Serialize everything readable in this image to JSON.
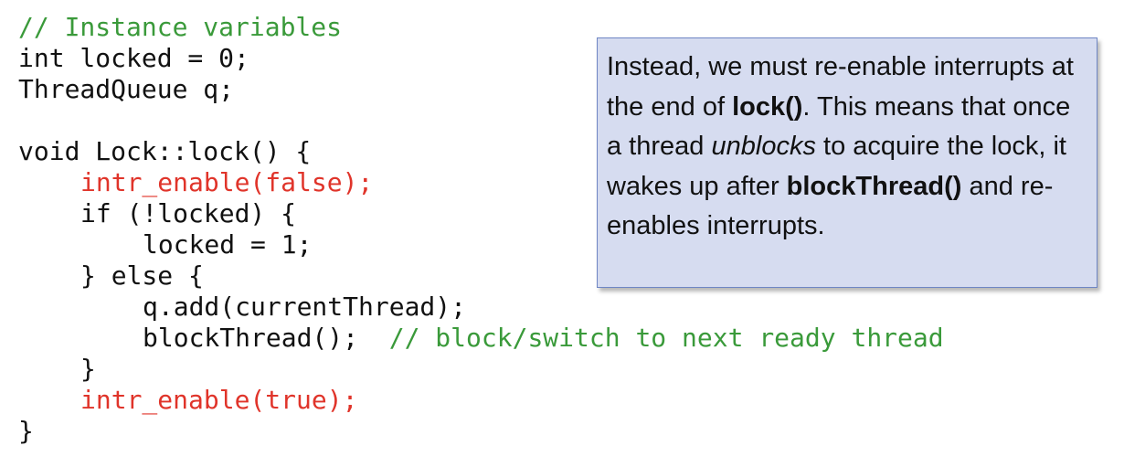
{
  "code": {
    "comment_instance": "// Instance variables",
    "line_int_locked": "int locked = 0;",
    "line_queue": "ThreadQueue q;",
    "line_func": "void Lock::lock() {",
    "line_intr_false": "intr_enable(false);",
    "line_if": "if (!locked) {",
    "line_locked_one": "locked = 1;",
    "line_else": "} else {",
    "line_qadd": "q.add(currentThread);",
    "line_block": "blockThread();",
    "comment_block": "// block/switch to next ready thread",
    "line_close_if": "}",
    "line_intr_true": "intr_enable(true);",
    "line_close_func": "}"
  },
  "callout": {
    "part1": "Instead, we must re-enable interrupts at the end of ",
    "lock_fn": "lock()",
    "part2": ".  This means that once a thread ",
    "unblocks": "unblocks",
    "part3": " to acquire the lock, it wakes up after ",
    "block_fn": "blockThread()",
    "part4": " and re-enables interrupts."
  },
  "colors": {
    "comment": "#3a9a3a",
    "highlight": "#e0342a",
    "callout_bg": "#d6dcf0",
    "callout_border": "#6f86c4"
  }
}
